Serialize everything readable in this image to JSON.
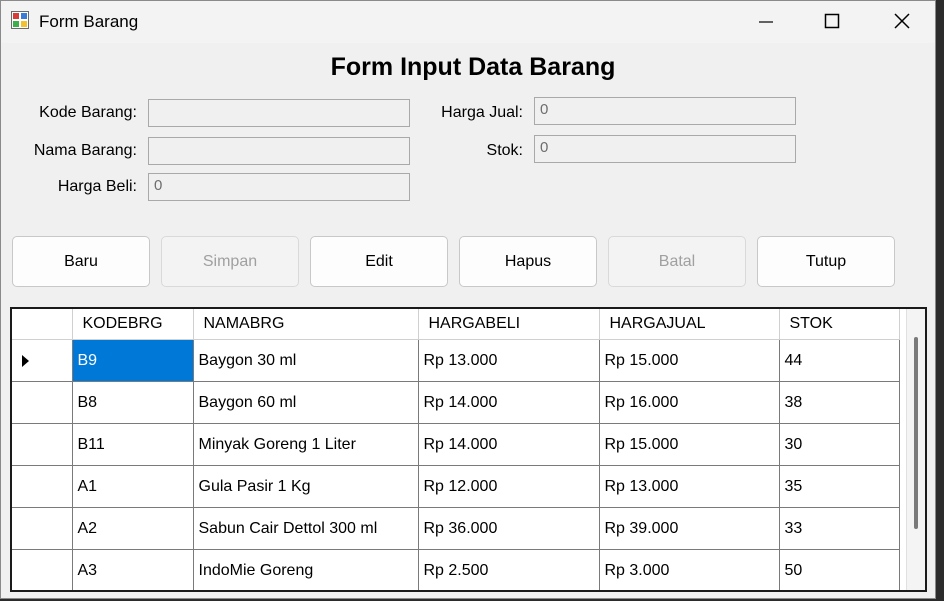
{
  "window": {
    "title": "Form Barang"
  },
  "form": {
    "heading": "Form Input Data Barang",
    "kode_label": "Kode Barang:",
    "kode_value": "",
    "nama_label": "Nama Barang:",
    "nama_value": "",
    "hbeli_label": "Harga Beli:",
    "hbeli_value": "0",
    "hjual_label": "Harga Jual:",
    "hjual_value": "0",
    "stok_label": "Stok:",
    "stok_value": "0"
  },
  "buttons": {
    "baru": "Baru",
    "simpan": "Simpan",
    "edit": "Edit",
    "hapus": "Hapus",
    "batal": "Batal",
    "tutup": "Tutup"
  },
  "grid": {
    "columns": [
      "KODEBRG",
      "NAMABRG",
      "HARGABELI",
      "HARGAJUAL",
      "STOK"
    ],
    "rows": [
      [
        "B9",
        "Baygon 30 ml",
        "Rp 13.000",
        "Rp 15.000",
        "44"
      ],
      [
        "B8",
        "Baygon 60 ml",
        "Rp 14.000",
        "Rp 16.000",
        "38"
      ],
      [
        "B11",
        "Minyak Goreng 1 Liter",
        "Rp 14.000",
        "Rp 15.000",
        "30"
      ],
      [
        "A1",
        "Gula Pasir 1 Kg",
        "Rp 12.000",
        "Rp 13.000",
        "35"
      ],
      [
        "A2",
        "Sabun Cair Dettol 300 ml",
        "Rp 36.000",
        "Rp 39.000",
        "33"
      ],
      [
        "A3",
        "IndoMie Goreng",
        "Rp 2.500",
        "Rp 3.000",
        "50"
      ]
    ],
    "selected_cell": [
      0,
      0
    ]
  },
  "colors": {
    "selection": "#0078d7"
  }
}
